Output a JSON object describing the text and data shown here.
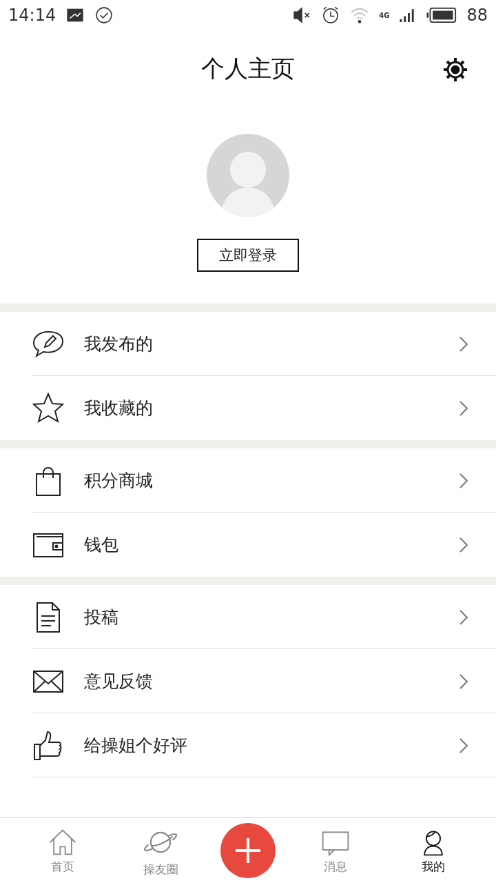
{
  "status_bar": {
    "time": "14:14",
    "network": "4G",
    "battery": "88"
  },
  "header": {
    "title": "个人主页"
  },
  "profile": {
    "login_button": "立即登录"
  },
  "menu_groups": [
    {
      "items": [
        {
          "label": "我发布的"
        },
        {
          "label": "我收藏的"
        }
      ]
    },
    {
      "items": [
        {
          "label": "积分商城"
        },
        {
          "label": "钱包"
        }
      ]
    },
    {
      "items": [
        {
          "label": "投稿"
        },
        {
          "label": "意见反馈"
        },
        {
          "label": "给操姐个好评"
        }
      ]
    }
  ],
  "bottom_nav": [
    {
      "kind": "tab",
      "label": "首页",
      "selected": false
    },
    {
      "kind": "tab",
      "label": "操友圈",
      "selected": false
    },
    {
      "kind": "action"
    },
    {
      "kind": "tab",
      "label": "消息",
      "selected": false
    },
    {
      "kind": "tab",
      "label": "我的",
      "selected": true
    }
  ]
}
